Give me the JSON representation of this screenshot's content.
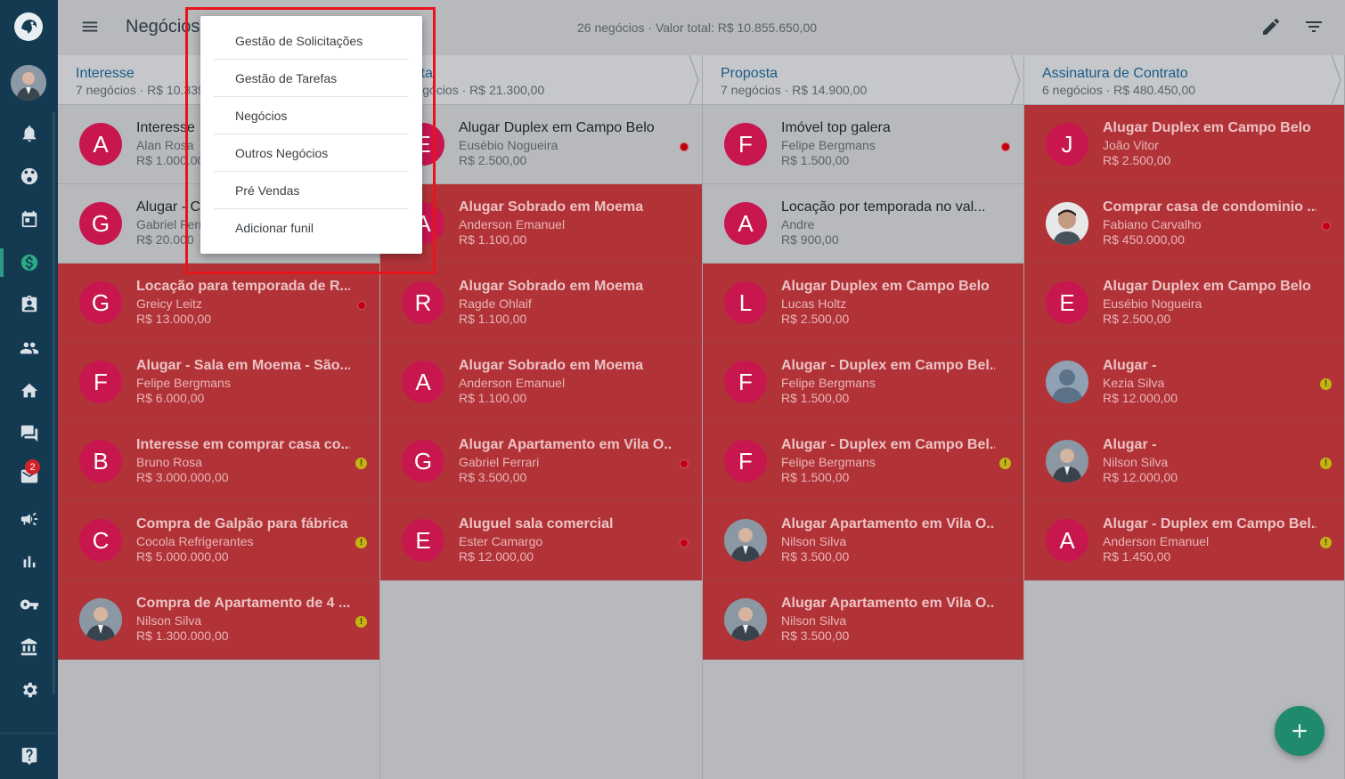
{
  "header": {
    "title": "Negócios",
    "summary": "26 negócios · Valor total: R$ 10.855.650,00"
  },
  "sidebar": {
    "mail_badge": "2"
  },
  "dropdown": {
    "items": [
      {
        "label": "Gestão de Solicitações"
      },
      {
        "label": "Gestão de Tarefas"
      },
      {
        "label": "Negócios"
      },
      {
        "label": "Outros Negócios"
      },
      {
        "label": "Pré Vendas"
      },
      {
        "label": "Adicionar funil"
      }
    ]
  },
  "columns": [
    {
      "title": "Interesse",
      "subtitle": "7 negócios · R$ 10.339",
      "cards": [
        {
          "title": "Interesse",
          "name": "Alan Rosa",
          "value": "R$ 1.000.000",
          "initial": "A",
          "style": "gray",
          "dot": "none",
          "avatar": "letter"
        },
        {
          "title": "Alugar - Ca",
          "name": "Gabriel Ferrari",
          "value": "R$ 20.000",
          "initial": "G",
          "style": "gray",
          "dot": "none",
          "avatar": "letter"
        },
        {
          "title": "Locação para temporada de R...",
          "name": "Greicy Leitz",
          "value": "R$ 13.000,00",
          "initial": "G",
          "style": "red",
          "dot": "red",
          "avatar": "letter"
        },
        {
          "title": "Alugar - Sala em Moema - São...",
          "name": "Felipe Bergmans",
          "value": "R$ 6.000,00",
          "initial": "F",
          "style": "red",
          "dot": "none",
          "avatar": "letter"
        },
        {
          "title": "Interesse em comprar casa co...",
          "name": "Bruno Rosa",
          "value": "R$ 3.000.000,00",
          "initial": "B",
          "style": "red",
          "dot": "warn",
          "avatar": "letter"
        },
        {
          "title": "Compra de Galpão para fábrica",
          "name": "Cocola Refrigerantes",
          "value": "R$ 5.000.000,00",
          "initial": "C",
          "style": "red",
          "dot": "warn",
          "avatar": "letter"
        },
        {
          "title": "Compra de Apartamento de 4 ...",
          "name": "Nilson Silva",
          "value": "R$ 1.300.000,00",
          "initial": "",
          "style": "red",
          "dot": "warn",
          "avatar": "photo-man"
        }
      ]
    },
    {
      "title": "Visita",
      "subtitle": "7 negócios · R$ 21.300,00",
      "cards": [
        {
          "title": "Alugar Duplex em Campo Belo",
          "name": "Eusébio Nogueira",
          "value": "R$ 2.500,00",
          "initial": "E",
          "style": "gray",
          "dot": "red",
          "avatar": "letter"
        },
        {
          "title": "Alugar Sobrado em Moema",
          "name": "Anderson Emanuel",
          "value": "R$ 1.100,00",
          "initial": "A",
          "style": "red",
          "dot": "none",
          "avatar": "letter"
        },
        {
          "title": "Alugar Sobrado em Moema",
          "name": "Ragde Ohlaif",
          "value": "R$ 1.100,00",
          "initial": "R",
          "style": "red",
          "dot": "none",
          "avatar": "letter"
        },
        {
          "title": "Alugar Sobrado em Moema",
          "name": "Anderson Emanuel",
          "value": "R$ 1.100,00",
          "initial": "A",
          "style": "red",
          "dot": "none",
          "avatar": "letter"
        },
        {
          "title": "Alugar Apartamento em Vila O...",
          "name": "Gabriel Ferrari",
          "value": "R$ 3.500,00",
          "initial": "G",
          "style": "red",
          "dot": "red",
          "avatar": "letter"
        },
        {
          "title": "Aluguel sala comercial",
          "name": "Ester Camargo",
          "value": "R$ 12.000,00",
          "initial": "E",
          "style": "red",
          "dot": "red",
          "avatar": "letter"
        }
      ]
    },
    {
      "title": "Proposta",
      "subtitle": "7 negócios · R$ 14.900,00",
      "cards": [
        {
          "title": "Imóvel top galera",
          "name": "Felipe Bergmans",
          "value": "R$ 1.500,00",
          "initial": "F",
          "style": "gray",
          "dot": "red",
          "avatar": "letter"
        },
        {
          "title": "Locação por temporada no val...",
          "name": "Andre",
          "value": "R$ 900,00",
          "initial": "A",
          "style": "gray",
          "dot": "none",
          "avatar": "letter"
        },
        {
          "title": "Alugar Duplex em Campo Belo",
          "name": "Lucas Holtz",
          "value": "R$ 2.500,00",
          "initial": "L",
          "style": "red",
          "dot": "none",
          "avatar": "letter"
        },
        {
          "title": "Alugar - Duplex em Campo Bel...",
          "name": "Felipe Bergmans",
          "value": "R$ 1.500,00",
          "initial": "F",
          "style": "red",
          "dot": "none",
          "avatar": "letter"
        },
        {
          "title": "Alugar - Duplex em Campo Bel...",
          "name": "Felipe Bergmans",
          "value": "R$ 1.500,00",
          "initial": "F",
          "style": "red",
          "dot": "warn",
          "avatar": "letter"
        },
        {
          "title": "Alugar Apartamento em Vila O...",
          "name": "Nilson Silva",
          "value": "R$ 3.500,00",
          "initial": "",
          "style": "red",
          "dot": "none",
          "avatar": "photo-man"
        },
        {
          "title": "Alugar Apartamento em Vila O...",
          "name": "Nilson Silva",
          "value": "R$ 3.500,00",
          "initial": "",
          "style": "red",
          "dot": "none",
          "avatar": "photo-man"
        }
      ]
    },
    {
      "title": "Assinatura de Contrato",
      "subtitle": "6 negócios · R$ 480.450,00",
      "cards": [
        {
          "title": "Alugar Duplex em Campo Belo",
          "name": "João Vitor",
          "value": "R$ 2.500,00",
          "initial": "J",
          "style": "red",
          "dot": "none",
          "avatar": "letter"
        },
        {
          "title": "Comprar casa de condominio ...",
          "name": "Fabiano Carvalho",
          "value": "R$ 450.000,00",
          "initial": "",
          "style": "red",
          "dot": "red",
          "avatar": "photo-young"
        },
        {
          "title": "Alugar Duplex em Campo Belo",
          "name": "Eusébio Nogueira",
          "value": "R$ 2.500,00",
          "initial": "E",
          "style": "red",
          "dot": "none",
          "avatar": "letter"
        },
        {
          "title": "Alugar -",
          "name": "Kezia Silva",
          "value": "R$ 12.000,00",
          "initial": "",
          "style": "red",
          "dot": "warn",
          "avatar": "photo-default"
        },
        {
          "title": "Alugar -",
          "name": "Nilson Silva",
          "value": "R$ 12.000,00",
          "initial": "",
          "style": "red",
          "dot": "warn",
          "avatar": "photo-man"
        },
        {
          "title": "Alugar - Duplex em Campo Bel...",
          "name": "Anderson Emanuel",
          "value": "R$ 1.450,00",
          "initial": "A",
          "style": "red",
          "dot": "warn",
          "avatar": "letter"
        }
      ]
    }
  ]
}
